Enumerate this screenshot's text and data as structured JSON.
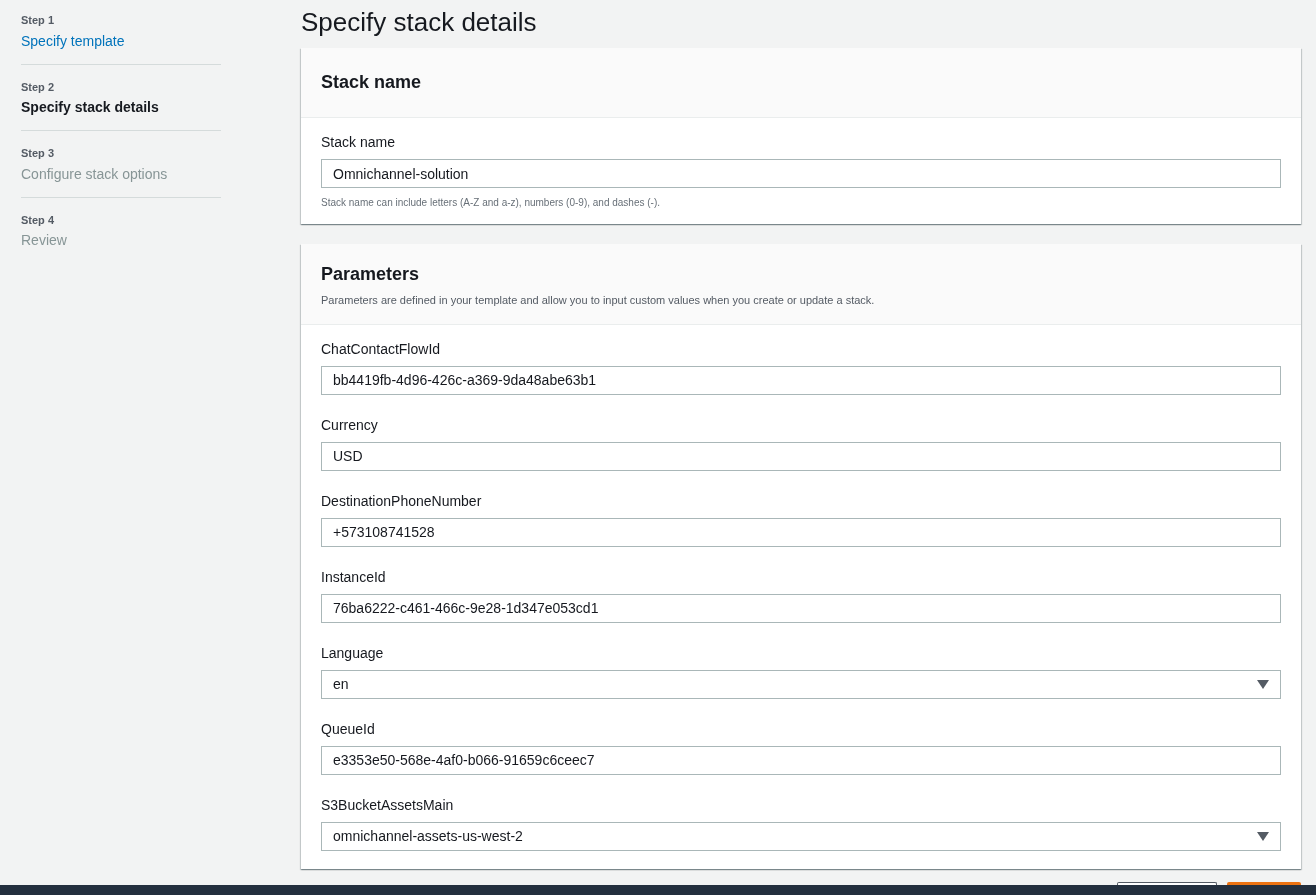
{
  "steps": [
    {
      "step": "Step 1",
      "title": "Specify template",
      "kind": "done"
    },
    {
      "step": "Step 2",
      "title": "Specify stack details",
      "kind": "current"
    },
    {
      "step": "Step 3",
      "title": "Configure stack options",
      "kind": "upcoming"
    },
    {
      "step": "Step 4",
      "title": "Review",
      "kind": "upcoming"
    }
  ],
  "page_title": "Specify stack details",
  "stack_name_card": {
    "heading": "Stack name",
    "label": "Stack name",
    "value": "Omnichannel-solution",
    "hint": "Stack name can include letters (A-Z and a-z), numbers (0-9), and dashes (-)."
  },
  "parameters_card": {
    "heading": "Parameters",
    "description": "Parameters are defined in your template and allow you to input custom values when you create or update a stack.",
    "fields": [
      {
        "label": "ChatContactFlowId",
        "value": "bb4419fb-4d96-426c-a369-9da48abe63b1",
        "kind": "text"
      },
      {
        "label": "Currency",
        "value": "USD",
        "kind": "text"
      },
      {
        "label": "DestinationPhoneNumber",
        "value": "+573108741528",
        "kind": "text"
      },
      {
        "label": "InstanceId",
        "value": "76ba6222-c461-466c-9e28-1d347e053cd1",
        "kind": "text"
      },
      {
        "label": "Language",
        "value": "en",
        "kind": "select"
      },
      {
        "label": "QueueId",
        "value": "e3353e50-568e-4af0-b066-91659c6ceec7",
        "kind": "text"
      },
      {
        "label": "S3BucketAssetsMain",
        "value": "omnichannel-assets-us-west-2",
        "kind": "select"
      }
    ]
  }
}
